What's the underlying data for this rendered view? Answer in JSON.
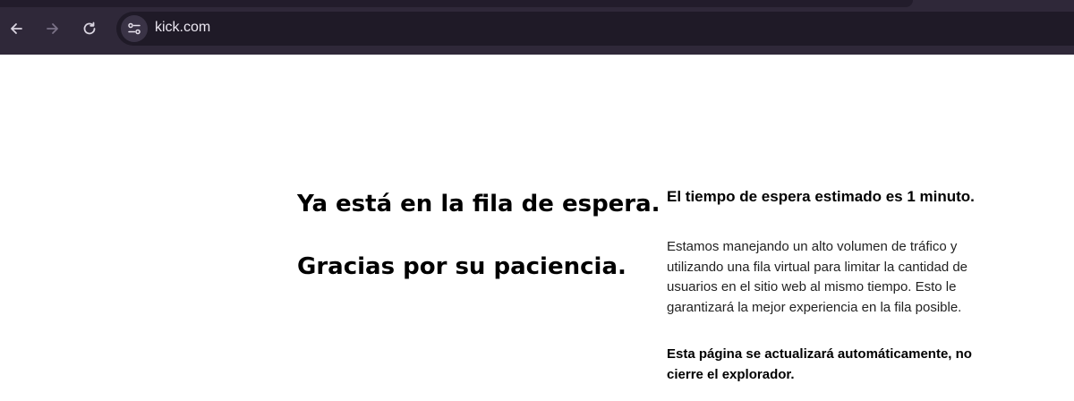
{
  "browser": {
    "url": "kick.com",
    "icons": {
      "back": "arrow-left-icon",
      "forward": "arrow-right-icon",
      "reload": "reload-icon",
      "site_info": "tune-icon"
    }
  },
  "queue": {
    "heading_line1": "Ya está en la fila de espera.",
    "heading_line2": "Gracias por su paciencia.",
    "estimate": "El tiempo de espera estimado es 1 minuto.",
    "description": "Estamos manejando un alto volumen de tráfico y utilizando una fila virtual para limitar la cantidad de usuarios en el sitio web al mismo tiempo. Esto le garantizará la mejor experiencia en la fila posible.",
    "note": "Esta página se actualizará automáticamente, no cierre el explorador."
  },
  "colors": {
    "chrome_bg": "#2f2839",
    "omnibox_bg": "#1f1a27",
    "page_bg": "#ffffff",
    "text": "#000000"
  }
}
